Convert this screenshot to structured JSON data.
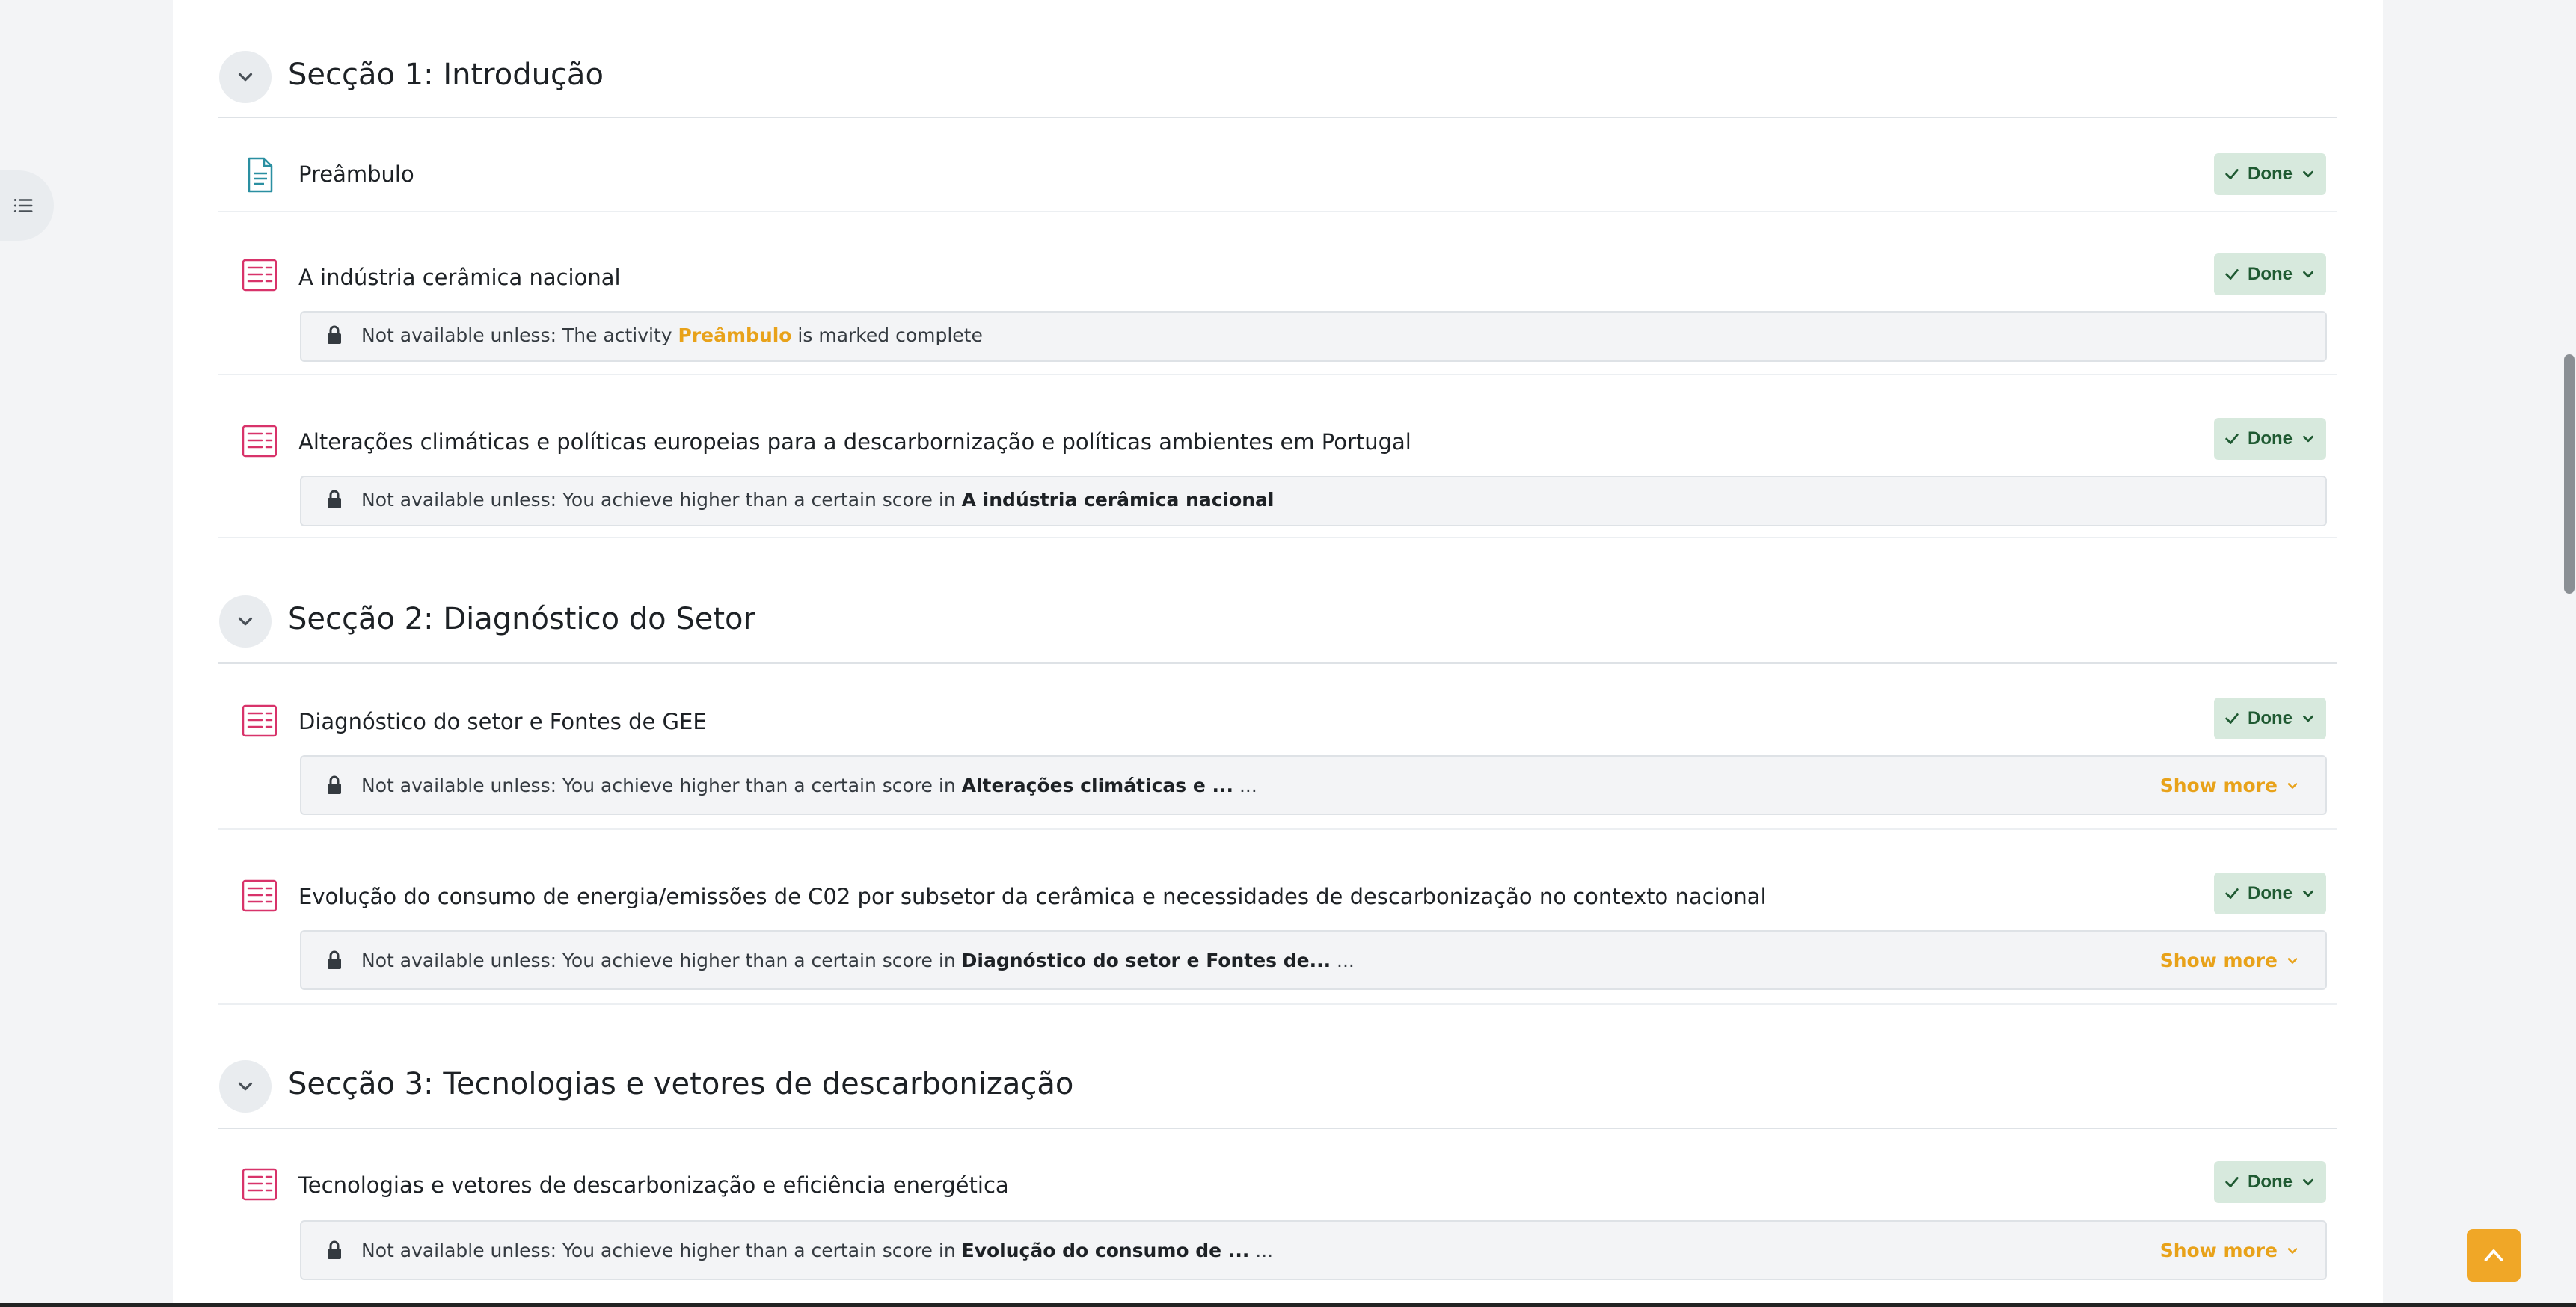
{
  "colors": {
    "done_bg": "#d7e9dd",
    "done_text": "#1f5a32",
    "link_accent": "#e8a21a",
    "page_icon": "#2a8fa1",
    "quiz_icon": "#d8336a",
    "back_to_top": "#f0a727"
  },
  "sections": [
    {
      "title": "Secção 1: Introdução"
    },
    {
      "title": "Secção 2: Diagnóstico do Setor"
    },
    {
      "title": "Secção 3: Tecnologias e vetores de descarbonização"
    }
  ],
  "activities": [
    {
      "name": "Preâmbulo",
      "icon": "page-icon",
      "status": "Done"
    },
    {
      "name": "A indústria cerâmica nacional",
      "icon": "quiz-icon",
      "status": "Done",
      "restriction": {
        "prefix": "Not available unless: The activity ",
        "ref": "Preâmbulo",
        "suffix": " is marked complete"
      }
    },
    {
      "name": "Alterações climáticas e políticas europeias para a descarbornização e políticas ambientes em Portugal",
      "icon": "quiz-icon",
      "status": "Done",
      "restriction": {
        "prefix": "Not available unless: You achieve higher than a certain score in ",
        "ref": "A indústria cerâmica nacional",
        "suffix": ""
      }
    },
    {
      "name": "Diagnóstico do setor e Fontes de GEE",
      "icon": "quiz-icon",
      "status": "Done",
      "restriction": {
        "prefix": "Not available unless: You achieve higher than a certain score in ",
        "ref": "Alterações climáticas e ...",
        "suffix": " ...",
        "show_more": "Show more"
      }
    },
    {
      "name": "Evolução do consumo de energia/emissões de C02 por subsetor da cerâmica e necessidades de descarbonização no contexto nacional",
      "icon": "quiz-icon",
      "status": "Done",
      "restriction": {
        "prefix": "Not available unless: You achieve higher than a certain score in ",
        "ref": "Diagnóstico do setor e Fontes de...",
        "suffix": " ...",
        "show_more": "Show more"
      }
    },
    {
      "name": "Tecnologias e vetores de descarbonização e eficiência energética",
      "icon": "quiz-icon",
      "status": "Done",
      "restriction": {
        "prefix": "Not available unless: You achieve higher than a certain score in ",
        "ref": "Evolução do consumo de ...",
        "suffix": " ...",
        "show_more": "Show more"
      }
    }
  ]
}
